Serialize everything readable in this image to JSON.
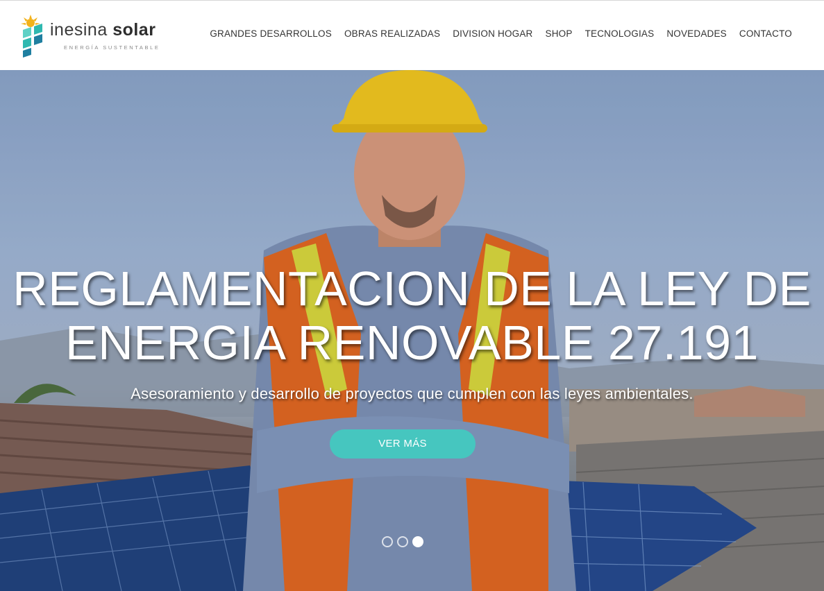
{
  "brand": {
    "name_light": "inesina",
    "name_bold": "solar",
    "tagline": "ENERGÍA SUSTENTABLE",
    "colors": {
      "teal": "#2fb8b0",
      "sun": "#f3b21b",
      "dark": "#1f7fa0"
    }
  },
  "nav": {
    "items": [
      {
        "label": "GRANDES DESARROLLOS"
      },
      {
        "label": "OBRAS REALIZADAS"
      },
      {
        "label": "DIVISION HOGAR"
      },
      {
        "label": "SHOP"
      },
      {
        "label": "TECNOLOGIAS"
      },
      {
        "label": "NOVEDADES"
      },
      {
        "label": "CONTACTO"
      }
    ]
  },
  "hero": {
    "title_line1": "REGLAMENTACION DE LA LEY DE",
    "title_line2": "ENERGIA RENOVABLE 27.191",
    "subtitle": "Asesoramiento y desarrollo de proyectos que cumplen con las leyes ambientales.",
    "button_label": "VER MÁS",
    "button_color": "#46c6bf",
    "slides_total": 3,
    "active_slide": 3
  }
}
